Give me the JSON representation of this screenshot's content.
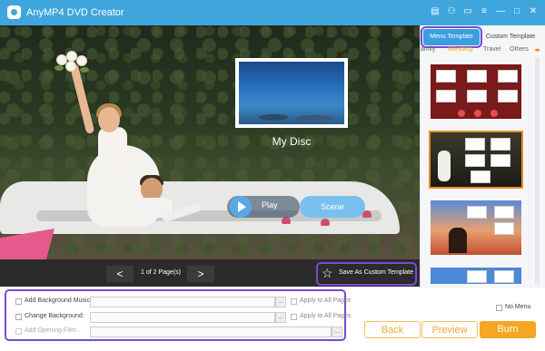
{
  "window": {
    "title": "AnyMP4 DVD Creator",
    "controls": [
      "cart-icon",
      "user-icon",
      "feedback-icon",
      "menu-icon",
      "minimize-icon",
      "maximize-icon",
      "close-icon"
    ]
  },
  "preview": {
    "disc_title": "My Disc",
    "play_label": "Play",
    "scene_label": "Scene"
  },
  "pager": {
    "prev": "<",
    "next": ">",
    "info": "1 of 2 Page(s)"
  },
  "save_template": {
    "label": "Save As Custom Template"
  },
  "template_panel": {
    "tabs": [
      "Menu Template",
      "Custom Template"
    ],
    "active_tab": "Menu Template",
    "categories": [
      "amily",
      "Wedding",
      "Travel",
      "Others"
    ],
    "active_category": "Wedding",
    "selected_template_index": 1
  },
  "options": {
    "background_music": {
      "label": "Add Background Music:",
      "value": "",
      "browse": "...",
      "apply_label": "Apply to All Pages"
    },
    "background": {
      "label": "Change Background:",
      "value": "",
      "browse": "...",
      "apply_label": "Apply to All Pages"
    },
    "opening_film": {
      "label": "Add Opening Film:",
      "value": "",
      "browse": "..."
    }
  },
  "no_menu": {
    "label": "No Menu"
  },
  "buttons": {
    "back": "Back",
    "preview": "Preview",
    "burn": "Burn"
  },
  "colors": {
    "titlebar": "#3ea6dc",
    "accent_orange": "#f5a623",
    "highlight_purple": "#7a4bd3",
    "tab_active": "#3a9ee0"
  }
}
